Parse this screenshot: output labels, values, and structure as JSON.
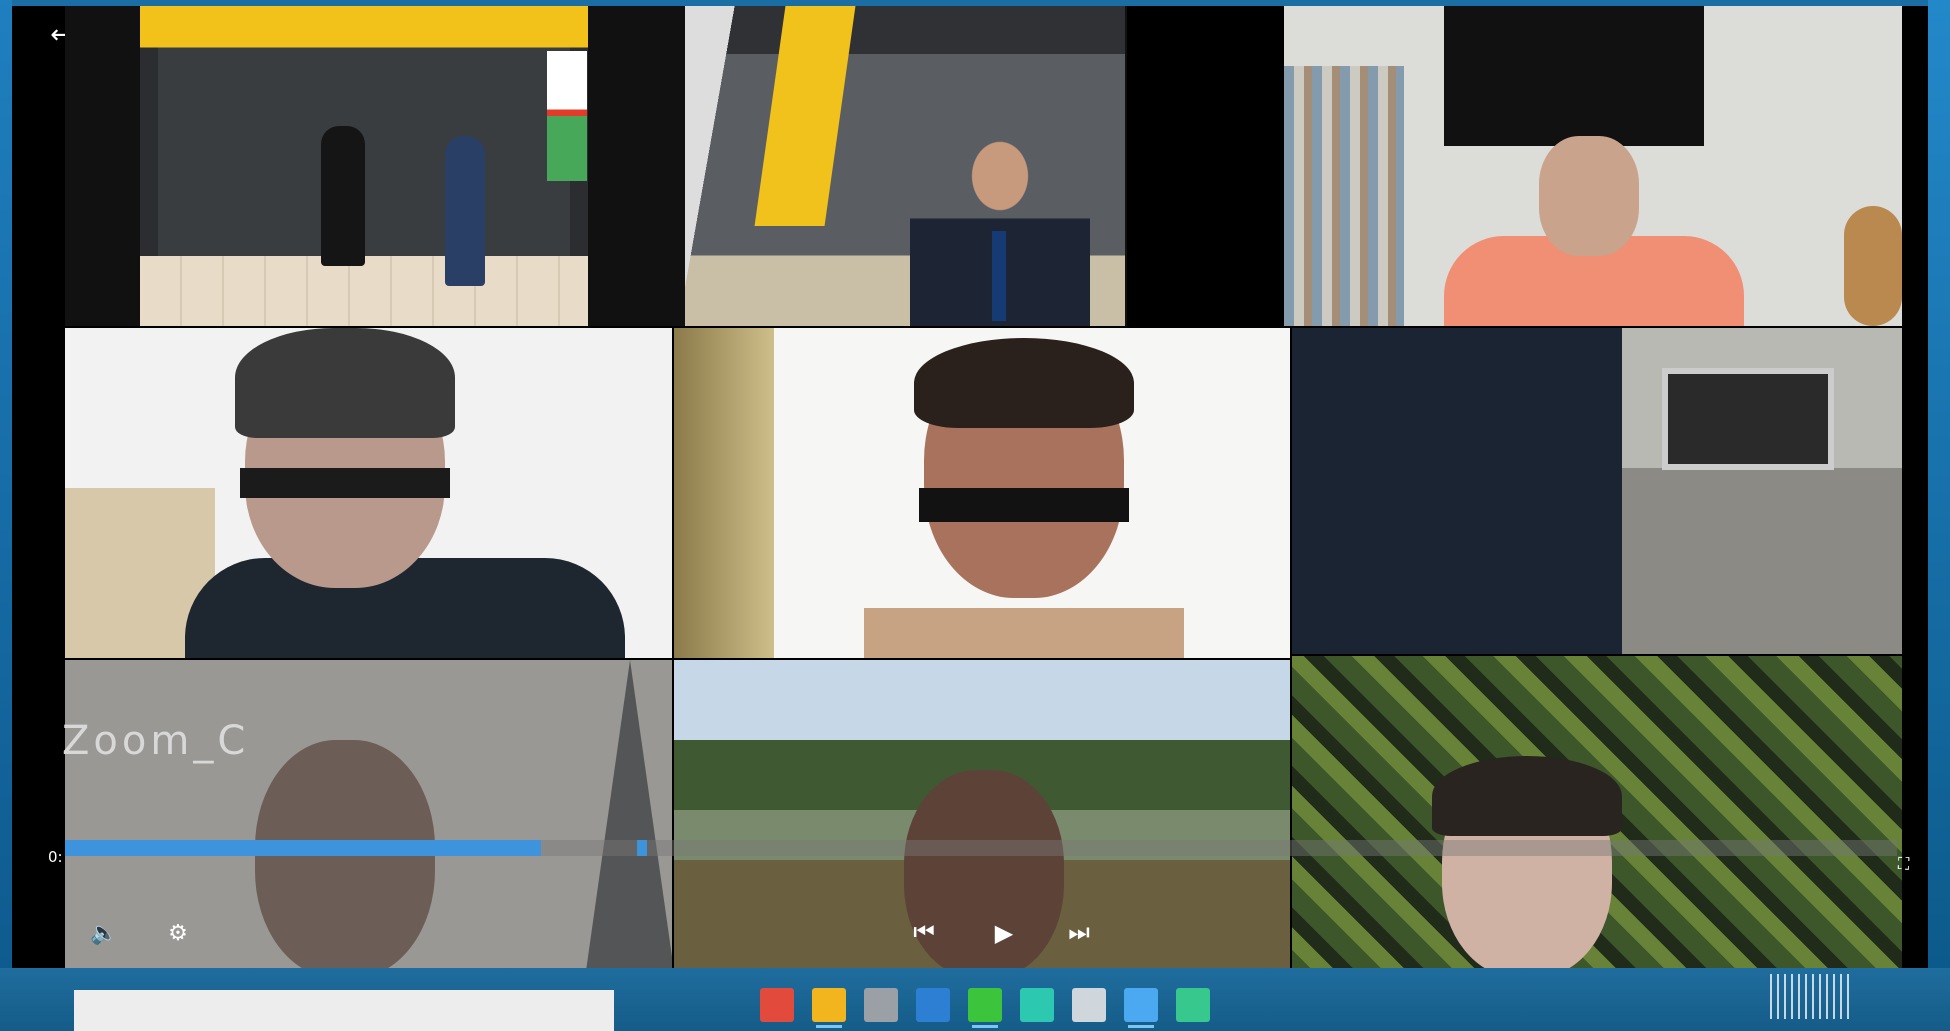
{
  "player": {
    "back_icon": "arrow-left-icon",
    "channel_name": "Zoom_C",
    "time_display": "0:",
    "progress_fraction": 0.26
  },
  "participants": [
    {
      "id": "tile-1",
      "label": ""
    },
    {
      "id": "tile-2",
      "label": ""
    },
    {
      "id": "tile-3",
      "label": ""
    },
    {
      "id": "tile-4",
      "label": ""
    },
    {
      "id": "tile-5",
      "label": ""
    },
    {
      "id": "tile-6",
      "label": ""
    },
    {
      "id": "tile-7",
      "label": ""
    },
    {
      "id": "tile-8",
      "label": ""
    },
    {
      "id": "tile-9",
      "label": ""
    }
  ],
  "taskbar": {
    "search_placeholder": "",
    "icons": [
      {
        "name": "app-red-icon",
        "color": "#e24a3b"
      },
      {
        "name": "app-yellow-icon",
        "color": "#f2b51d"
      },
      {
        "name": "app-gray-icon",
        "color": "#9aa0a6"
      },
      {
        "name": "app-blue-icon",
        "color": "#2d7fd3"
      },
      {
        "name": "app-green-icon",
        "color": "#3cc43c"
      },
      {
        "name": "app-teal-icon",
        "color": "#2cc9b0"
      },
      {
        "name": "app-lightgray-icon",
        "color": "#cfd6dc"
      },
      {
        "name": "app-sky-icon",
        "color": "#4aa9f0"
      },
      {
        "name": "app-mint-icon",
        "color": "#36c88c"
      }
    ]
  },
  "colors": {
    "accent": "#3d94dd",
    "taskbar": "#155c88"
  }
}
